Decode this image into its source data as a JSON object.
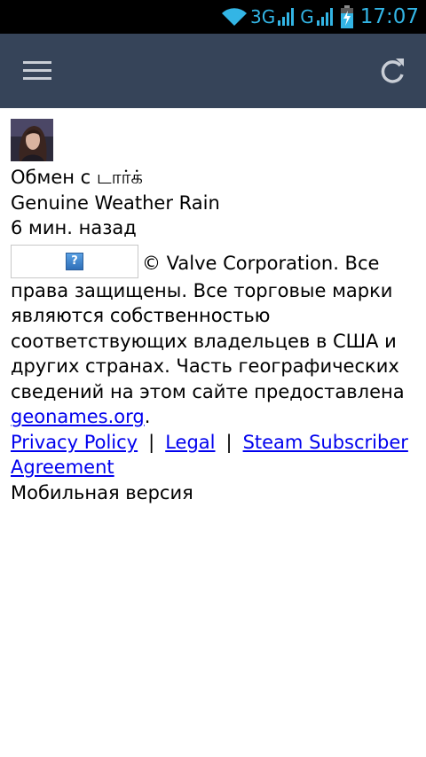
{
  "status_bar": {
    "network_3g": "3G",
    "network_g": "G",
    "time": "17:07",
    "icons": [
      "wifi-icon",
      "signal-icon",
      "signal-icon",
      "battery-charging-icon"
    ],
    "accent_color": "#33b5e5"
  },
  "app_bar": {
    "background": "#364459",
    "menu_icon": "hamburger-menu-icon",
    "refresh_icon": "refresh-icon"
  },
  "trade": {
    "title": "Обмен с டார்க்",
    "item_name": "Genuine Weather Rain",
    "time_ago": "6 мин. назад"
  },
  "footer": {
    "copyright_text": "© Valve Corporation. Все права защищены. Все торговые марки являются собственностью соответствующих владельцев в США и других странах. Часть географических сведений на этом сайте предоставлена ",
    "geonames_link": "geonames.org",
    "period": ".",
    "links": {
      "privacy": "Privacy Policy",
      "legal": "Legal",
      "ssa": "Steam Subscriber Agreement",
      "separator": "|"
    },
    "mobile_version": "Мобильная версия"
  }
}
